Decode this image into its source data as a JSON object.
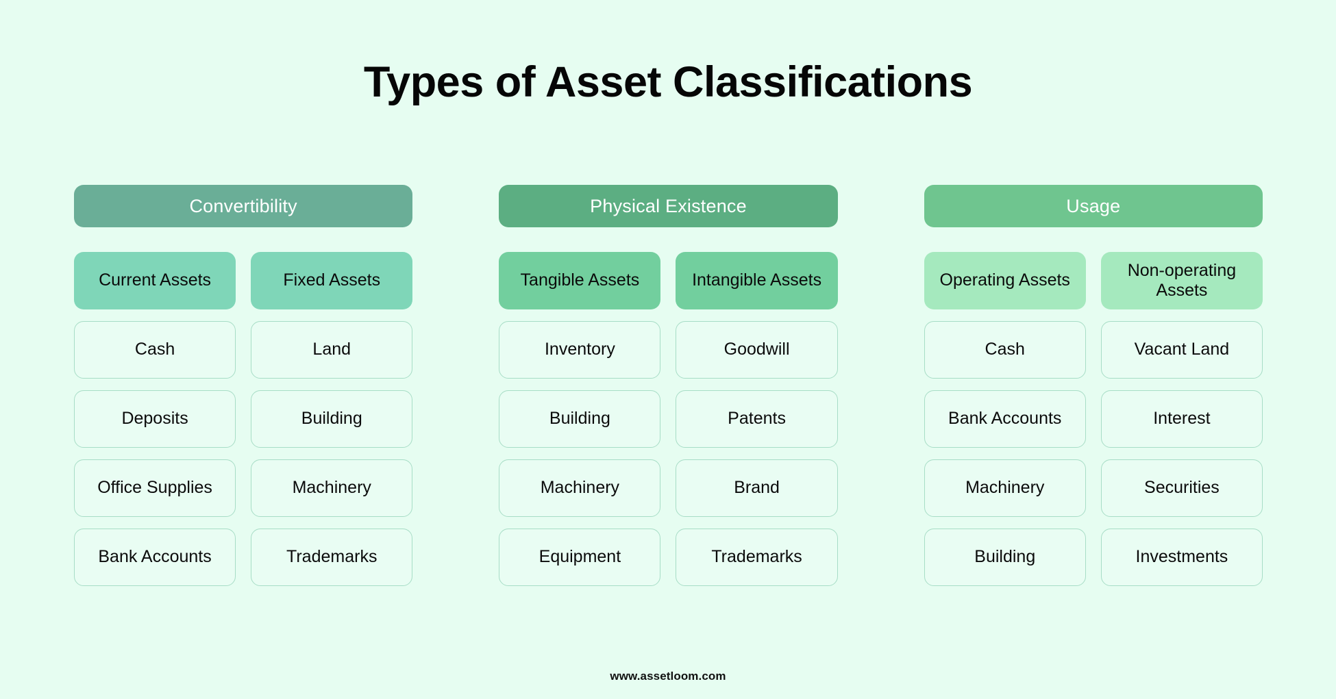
{
  "title": "Types of Asset Classifications",
  "footer": "www.assetloom.com",
  "palette": {
    "page_background": "#e6fdf1",
    "item_cell_background": "#e9fdf3",
    "item_cell_border": "#a7ddc6",
    "title_color": "#060606",
    "header_text_color": "#ffffff"
  },
  "columns": [
    {
      "header": "Convertibility",
      "header_color": "#6aae97",
      "subcat_color": "#7fd6b8",
      "subcategories": [
        "Current Assets",
        "Fixed Assets"
      ],
      "rows": [
        [
          "Cash",
          "Land"
        ],
        [
          "Deposits",
          "Building"
        ],
        [
          "Office Supplies",
          "Machinery"
        ],
        [
          "Bank Accounts",
          "Trademarks"
        ]
      ]
    },
    {
      "header": "Physical Existence",
      "header_color": "#5cae82",
      "subcat_color": "#72cf9e",
      "subcategories": [
        "Tangible Assets",
        "Intangible Assets"
      ],
      "rows": [
        [
          "Inventory",
          "Goodwill"
        ],
        [
          "Building",
          "Patents"
        ],
        [
          "Machinery",
          "Brand"
        ],
        [
          "Equipment",
          "Trademarks"
        ]
      ]
    },
    {
      "header": "Usage",
      "header_color": "#6fc58f",
      "subcat_color": "#a5e9be",
      "subcategories": [
        "Operating Assets",
        "Non-operating Assets"
      ],
      "rows": [
        [
          "Cash",
          "Vacant Land"
        ],
        [
          "Bank Accounts",
          "Interest"
        ],
        [
          "Machinery",
          "Securities"
        ],
        [
          "Building",
          "Investments"
        ]
      ]
    }
  ]
}
